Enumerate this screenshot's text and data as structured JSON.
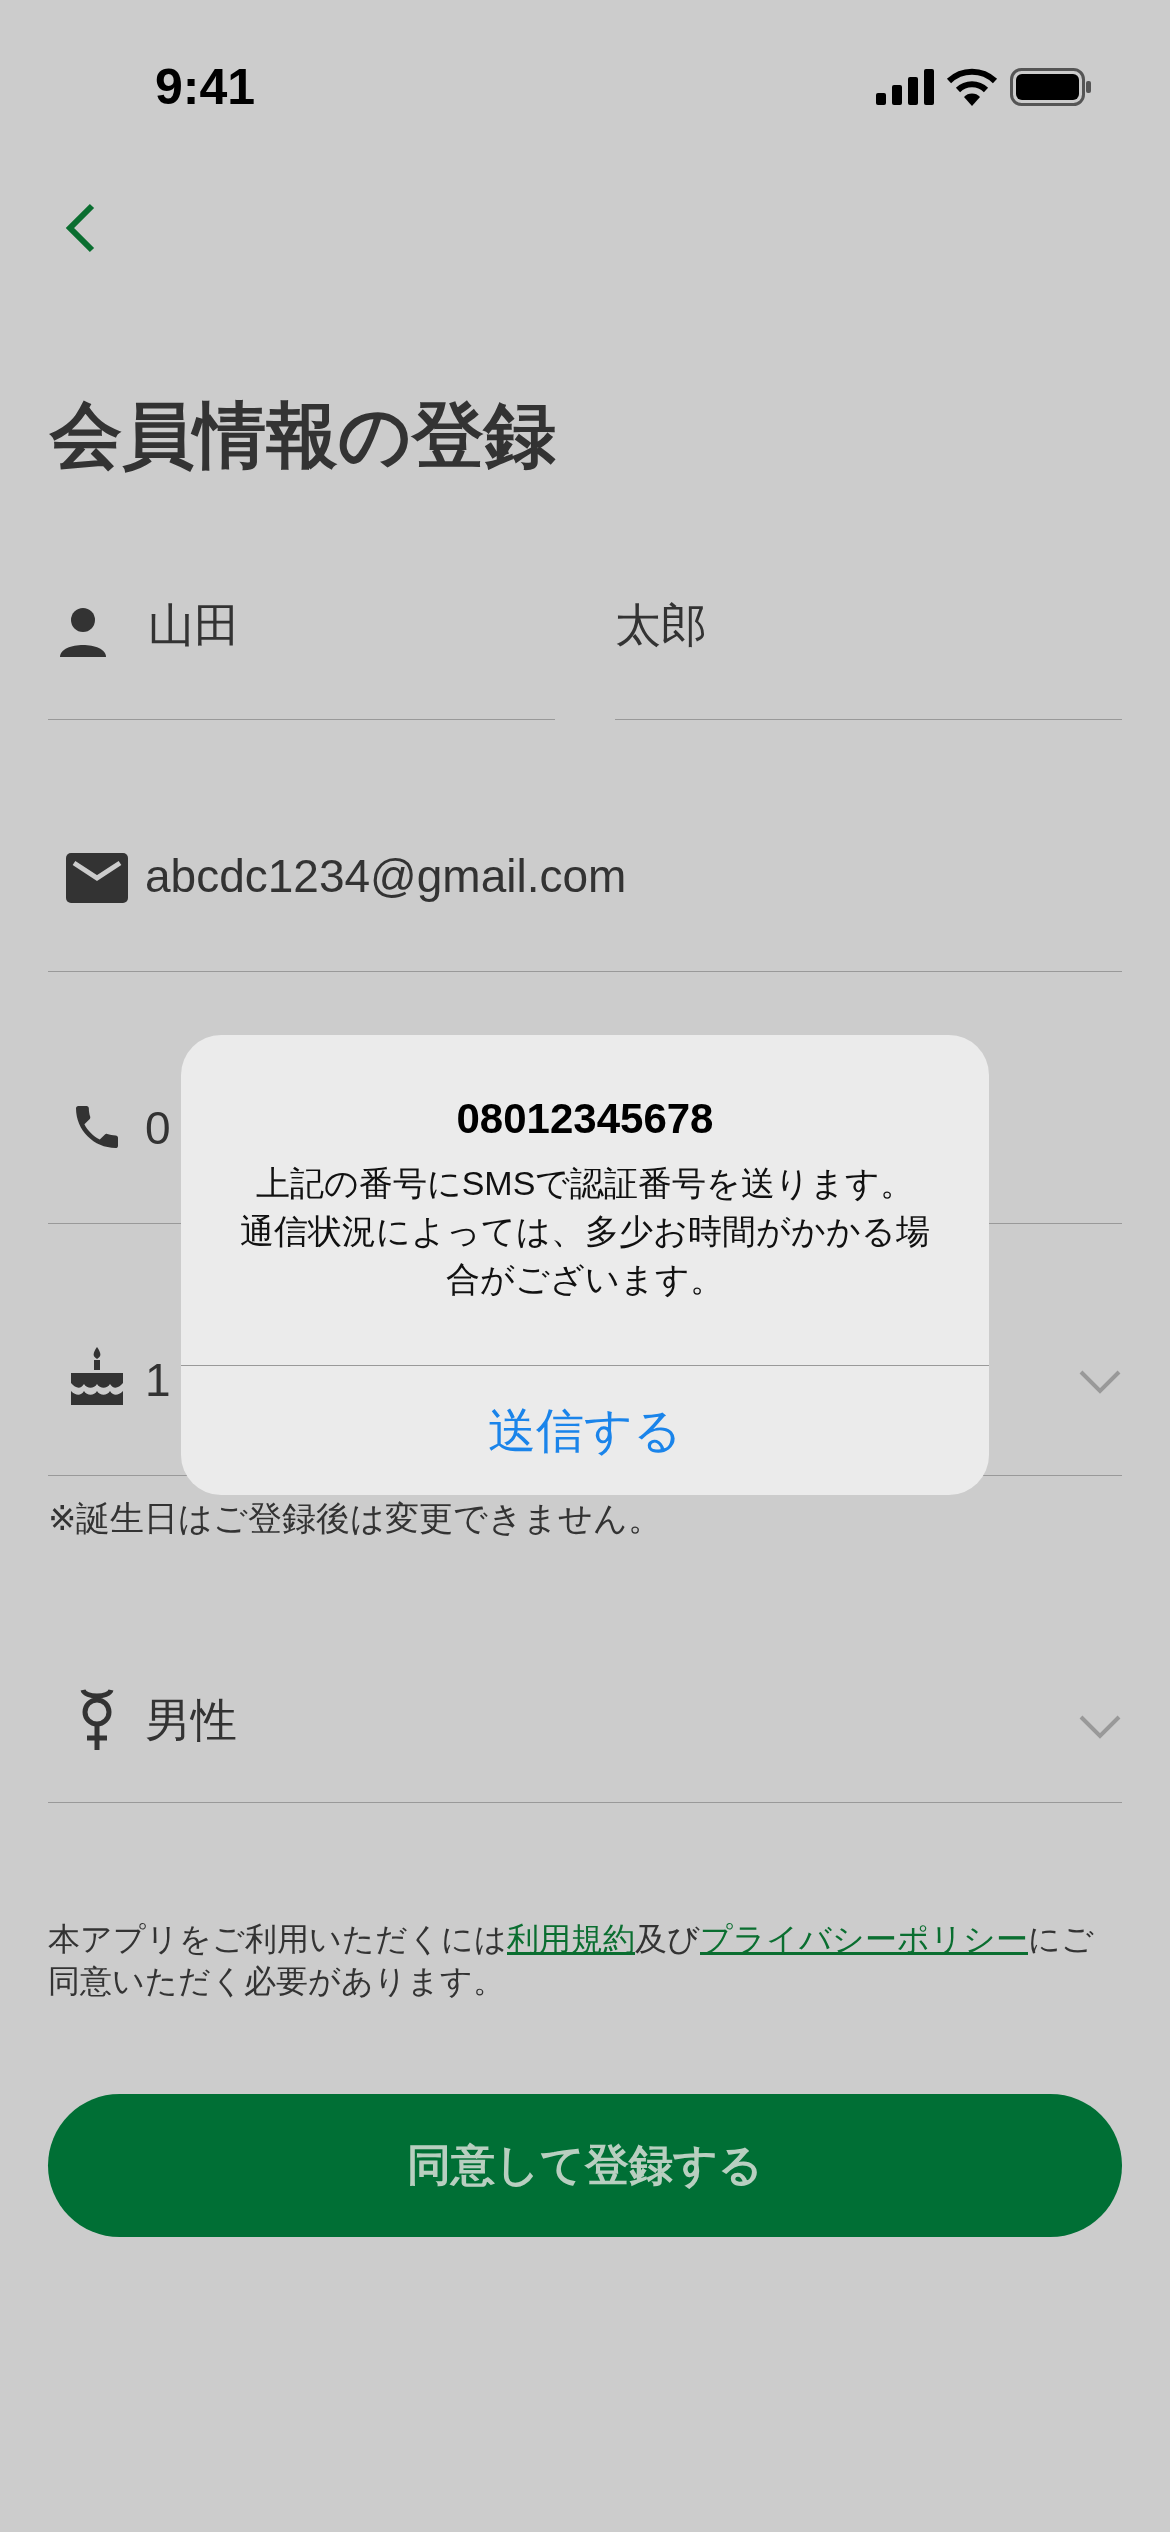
{
  "status_bar": {
    "time": "9:41"
  },
  "title": "会員情報の登録",
  "name_fields": [
    {
      "value": "山田"
    },
    {
      "value": "太郎"
    }
  ],
  "fields": [
    {
      "kind": "email",
      "value": "abcdc1234@gmail.com",
      "dropdown": false
    },
    {
      "kind": "phone",
      "value": "0",
      "dropdown": false
    },
    {
      "kind": "birthday",
      "value": "1",
      "dropdown": true,
      "note": "※誕生日はご登録後は変更できません。"
    },
    {
      "kind": "gender",
      "value": "男性",
      "dropdown": true
    }
  ],
  "terms": [
    {
      "text": "本アプリをご利用いただくには",
      "link": false
    },
    {
      "text": "利用規約",
      "link": true
    },
    {
      "text": "及び",
      "link": false
    },
    {
      "text": "プライバシーポリシー",
      "link": true
    },
    {
      "text": "にご同意いただく必要があります。",
      "link": false
    }
  ],
  "submit_button": "同意して登録する",
  "dialog": {
    "title": "08012345678",
    "message": [
      "上記の番号にSMSで認証番号を送ります。",
      "通信状況によっては、多少お時間がかかる場合がございます。"
    ],
    "action": "送信する"
  }
}
